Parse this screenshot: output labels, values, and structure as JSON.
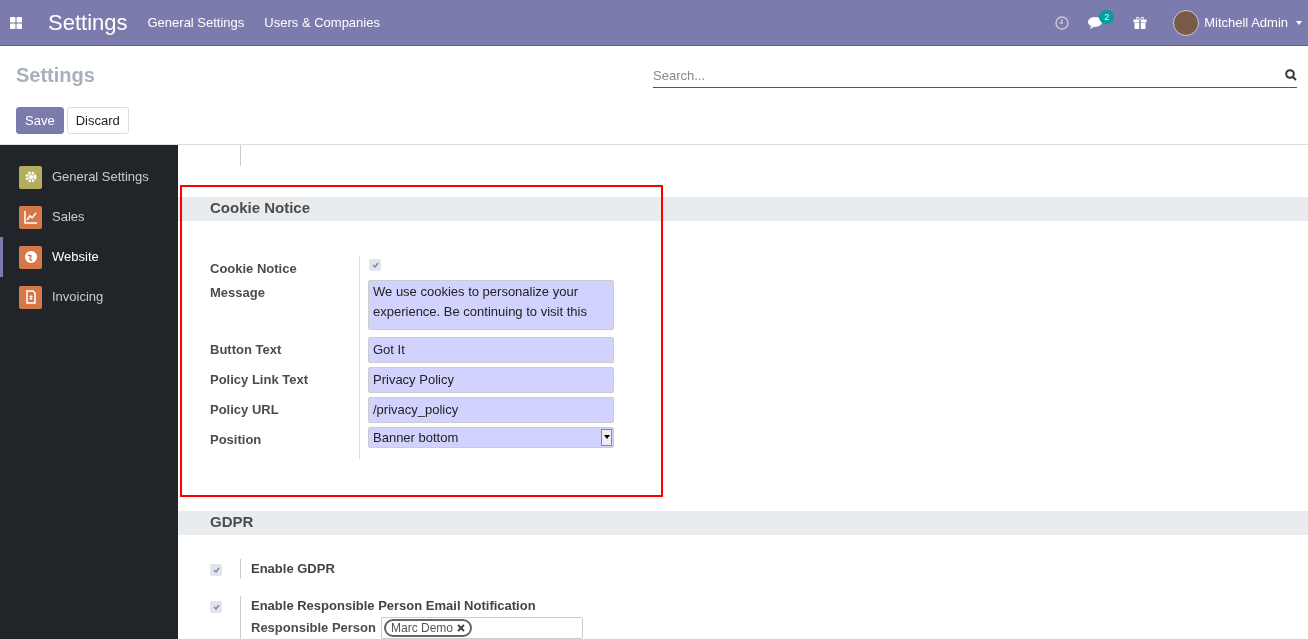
{
  "navbar": {
    "app_title": "Settings",
    "menu": [
      "General Settings",
      "Users & Companies"
    ],
    "messages_badge": "2",
    "user_name": "Mitchell Admin"
  },
  "control_panel": {
    "title": "Settings",
    "search": {
      "placeholder": "Search..."
    },
    "buttons": [
      {
        "label": "Save",
        "kind": "primary"
      },
      {
        "label": "Discard",
        "kind": "secondary"
      }
    ]
  },
  "sidebar": {
    "items": [
      {
        "label": "General Settings",
        "selected": false,
        "color": "#b5ad5e"
      },
      {
        "label": "Sales",
        "selected": false,
        "color": "#d4784a"
      },
      {
        "label": "Website",
        "selected": true,
        "color": "#d4784a"
      },
      {
        "label": "Invoicing",
        "selected": false,
        "color": "#d4784a"
      }
    ]
  },
  "cookie_notice": {
    "title": "Cookie Notice",
    "fields": [
      {
        "kind": "checkbox",
        "label": "Cookie Notice",
        "checked": true
      },
      {
        "kind": "textarea",
        "label": "Message",
        "value": "We use cookies to personalize your experience. Be continuing to visit this"
      },
      {
        "kind": "text",
        "label": "Button Text",
        "value": "Got It"
      },
      {
        "kind": "text",
        "label": "Policy Link Text",
        "value": "Privacy Policy"
      },
      {
        "kind": "text",
        "label": "Policy URL",
        "value": "/privacy_policy"
      },
      {
        "kind": "select",
        "label": "Position",
        "value": "Banner bottom"
      }
    ]
  },
  "gdpr": {
    "title": "GDPR",
    "settings": [
      {
        "label": "Enable GDPR",
        "checked": true
      },
      {
        "label": "Enable Responsible Person Email Notification",
        "checked": true,
        "field_label": "Responsible Person",
        "tags": [
          "Marc Demo"
        ]
      }
    ]
  }
}
